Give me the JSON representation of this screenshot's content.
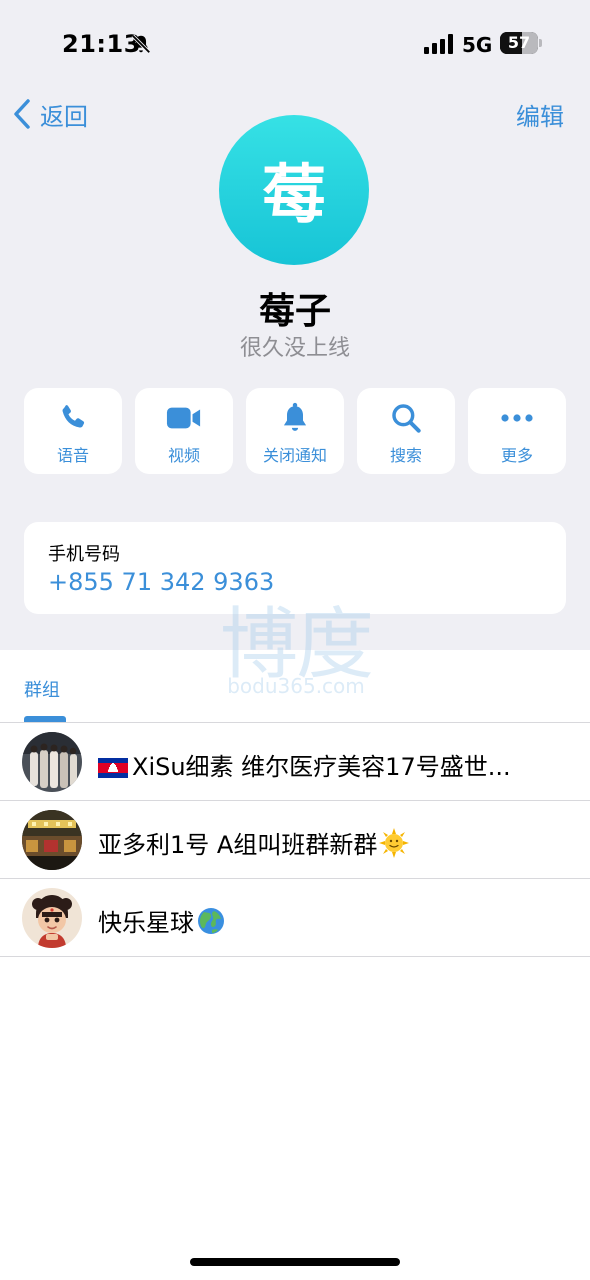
{
  "status_bar": {
    "time": "21:13",
    "network": "5G",
    "battery_percent": "57",
    "battery_level": 0.57
  },
  "nav": {
    "back_label": "返回",
    "edit_label": "编辑"
  },
  "profile": {
    "avatar_initial": "莓",
    "name": "莓子",
    "last_seen": "很久没上线"
  },
  "actions": [
    {
      "label": "语音",
      "icon": "phone-icon"
    },
    {
      "label": "视频",
      "icon": "video-icon"
    },
    {
      "label": "关闭通知",
      "icon": "bell-icon"
    },
    {
      "label": "搜索",
      "icon": "search-icon"
    },
    {
      "label": "更多",
      "icon": "more-icon"
    }
  ],
  "phone": {
    "caption": "手机号码",
    "number": "+855 71 342 9363"
  },
  "watermark": {
    "logo": "博度",
    "url": "bodu365.com"
  },
  "groups_tab": {
    "label": "群组"
  },
  "groups": [
    {
      "title": "XiSu细素 维尔医疗美容17号盛世...",
      "flag": "cambodia-flag"
    },
    {
      "title": "亚多利1号 A组叫班群新群",
      "emoji": "sun-face-emoji"
    },
    {
      "title": "快乐星球",
      "emoji": "globe-emoji"
    }
  ],
  "colors": {
    "accent": "#3b8fd9",
    "background": "#efeff4",
    "avatar": "#1ecfdc"
  }
}
